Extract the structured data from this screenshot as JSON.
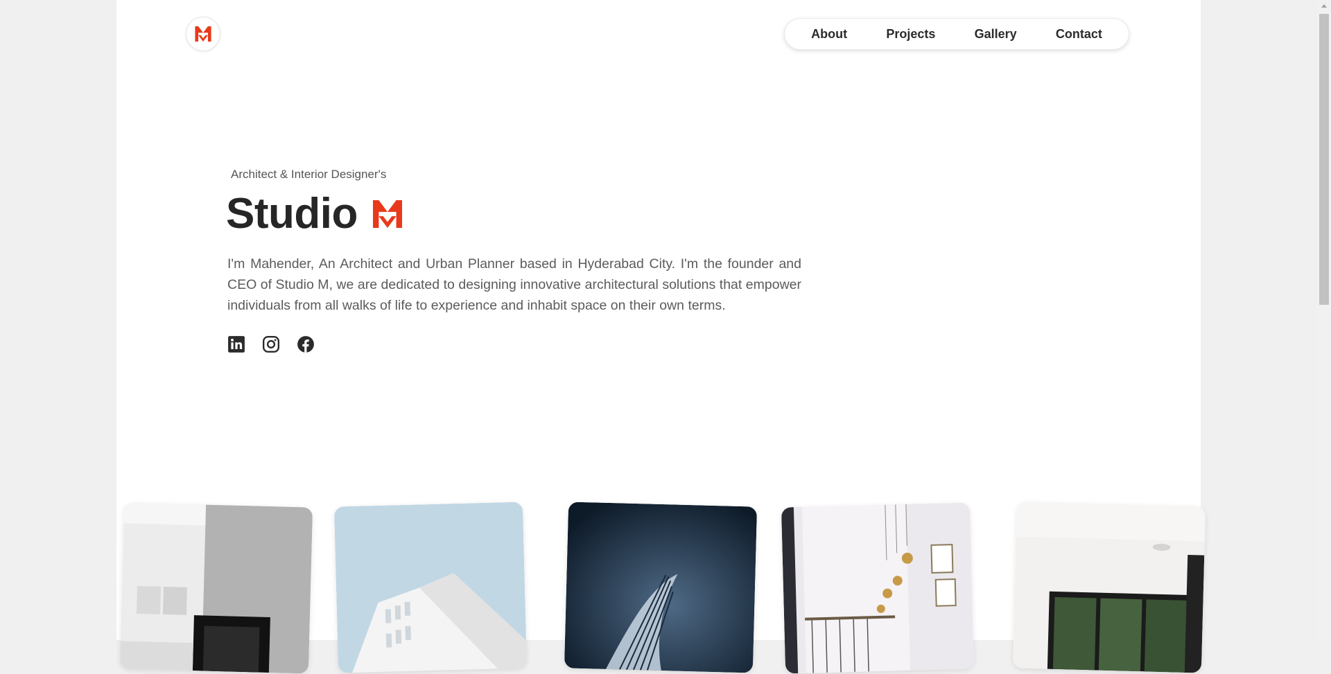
{
  "header": {
    "logo_icon": "studio-m-logo",
    "nav": [
      {
        "label": "About"
      },
      {
        "label": "Projects"
      },
      {
        "label": "Gallery"
      },
      {
        "label": "Contact"
      }
    ]
  },
  "hero": {
    "tagline": "Architect & Interior Designer's",
    "title": "Studio",
    "title_logo_icon": "studio-m-logo",
    "intro": "I'm Mahender, An Architect and Urban Planner based in Hyderabad City. I'm the founder and CEO of Studio M, we are dedicated to designing innovative architectural solutions that empower individuals from all walks of life to experience and inhabit space on their own terms.",
    "socials": [
      {
        "icon": "linkedin-icon"
      },
      {
        "icon": "instagram-icon"
      },
      {
        "icon": "facebook-icon"
      }
    ]
  },
  "gallery": [
    {
      "subject": "interior-fireplace-photo"
    },
    {
      "subject": "white-building-sky-photo"
    },
    {
      "subject": "spiral-architecture-photo"
    },
    {
      "subject": "staircase-pendant-lights-photo"
    },
    {
      "subject": "living-room-windows-photo"
    }
  ],
  "colors": {
    "brand_red": "#e8391b",
    "text_dark": "#262626",
    "text_body": "#5b5b5b",
    "page_bg": "#ffffff",
    "outer_bg": "#f0f0f0"
  }
}
